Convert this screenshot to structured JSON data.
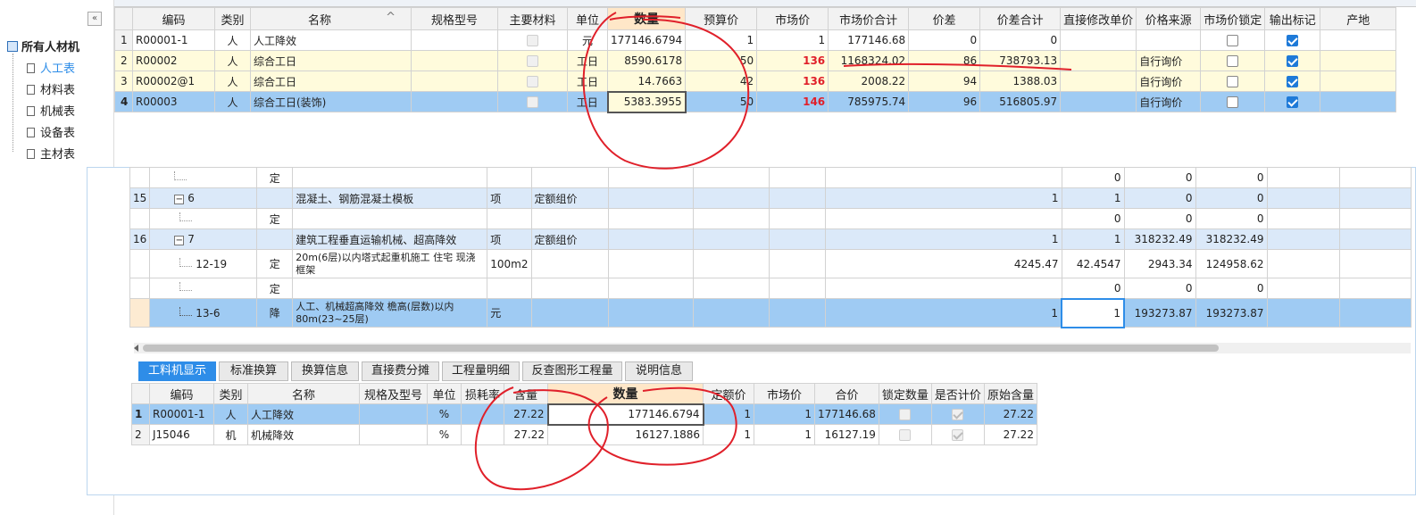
{
  "sidebar": {
    "collapse": "«",
    "root": "所有人材机",
    "items": [
      "人工表",
      "材料表",
      "机械表",
      "设备表",
      "主材表"
    ]
  },
  "top": {
    "headers": [
      "编码",
      "类别",
      "名称",
      "规格型号",
      "主要材料",
      "单位",
      "数量",
      "预算价",
      "市场价",
      "市场价合计",
      "价差",
      "价差合计",
      "直接修改单价",
      "价格来源",
      "市场价锁定",
      "输出标记",
      "产地"
    ],
    "name_sort": "^",
    "rows": [
      {
        "n": "1",
        "code": "R00001-1",
        "cat": "人",
        "name": "人工降效",
        "unit": "元",
        "qty": "177146.6794",
        "budget": "1",
        "market": "1",
        "mtotal": "177146.68",
        "diff": "0",
        "dtotal": "0",
        "src": ""
      },
      {
        "n": "2",
        "code": "R00002",
        "cat": "人",
        "name": "综合工日",
        "unit": "工日",
        "qty": "8590.6178",
        "budget": "50",
        "market": "136",
        "mtotal": "1168324.02",
        "diff": "86",
        "dtotal": "738793.13",
        "src": "自行询价"
      },
      {
        "n": "3",
        "code": "R00002@1",
        "cat": "人",
        "name": "综合工日",
        "unit": "工日",
        "qty": "14.7663",
        "budget": "42",
        "market": "136",
        "mtotal": "2008.22",
        "diff": "94",
        "dtotal": "1388.03",
        "src": "自行询价"
      },
      {
        "n": "4",
        "code": "R00003",
        "cat": "人",
        "name": "综合工日(装饰)",
        "unit": "工日",
        "qty": "5383.3955",
        "budget": "50",
        "market": "146",
        "mtotal": "785975.74",
        "diff": "96",
        "dtotal": "516805.97",
        "src": "自行询价"
      }
    ]
  },
  "mid": {
    "rows": [
      {
        "n": "",
        "code": "",
        "type": "定",
        "name": "",
        "unit": "",
        "att": "",
        "c1": "",
        "c2": "0",
        "c3": "0",
        "c4": "0"
      },
      {
        "n": "15",
        "code": "6",
        "type": "",
        "name": "混凝土、钢筋混凝土模板",
        "unit": "项",
        "att": "定额组价",
        "c1": "1",
        "c2": "1",
        "c3": "0",
        "c4": "0"
      },
      {
        "n": "",
        "code": "",
        "type": "定",
        "name": "",
        "unit": "",
        "att": "",
        "c1": "",
        "c2": "0",
        "c3": "0",
        "c4": "0"
      },
      {
        "n": "16",
        "code": "7",
        "type": "",
        "name": "建筑工程垂直运输机械、超高降效",
        "unit": "项",
        "att": "定额组价",
        "c1": "1",
        "c2": "1",
        "c3": "318232.49",
        "c4": "318232.49"
      },
      {
        "n": "",
        "code": "12-19",
        "type": "定",
        "name": "20m(6层)以内塔式起重机施工 住宅 现浇框架",
        "unit": "100m2",
        "att": "",
        "c1": "4245.47",
        "c2": "42.4547",
        "c3": "2943.34",
        "c4": "124958.62"
      },
      {
        "n": "",
        "code": "",
        "type": "定",
        "name": "",
        "unit": "",
        "att": "",
        "c1": "",
        "c2": "0",
        "c3": "0",
        "c4": "0"
      },
      {
        "n": "",
        "code": "13-6",
        "type": "降",
        "name": "人工、机械超高降效 檐高(层数)以内80m(23~25层)",
        "unit": "元",
        "att": "",
        "c1": "1",
        "c2": "1",
        "c3": "193273.87",
        "c4": "193273.87"
      }
    ]
  },
  "tabs": [
    "工料机显示",
    "标准换算",
    "换算信息",
    "直接费分摊",
    "工程量明细",
    "反查图形工程量",
    "说明信息"
  ],
  "bottom": {
    "headers": [
      "编码",
      "类别",
      "名称",
      "规格及型号",
      "单位",
      "损耗率",
      "含量",
      "数量",
      "定额价",
      "市场价",
      "合价",
      "锁定数量",
      "是否计价",
      "原始含量"
    ],
    "rows": [
      {
        "n": "1",
        "code": "R00001-1",
        "cat": "人",
        "name": "人工降效",
        "unit": "%",
        "amount": "27.22",
        "qty": "177146.6794",
        "quota": "1",
        "market": "1",
        "total": "177146.68",
        "orig": "27.22"
      },
      {
        "n": "2",
        "code": "J15046",
        "cat": "机",
        "name": "机械降效",
        "unit": "%",
        "amount": "27.22",
        "qty": "16127.1886",
        "quota": "1",
        "market": "1",
        "total": "16127.19",
        "orig": "27.22"
      }
    ]
  }
}
